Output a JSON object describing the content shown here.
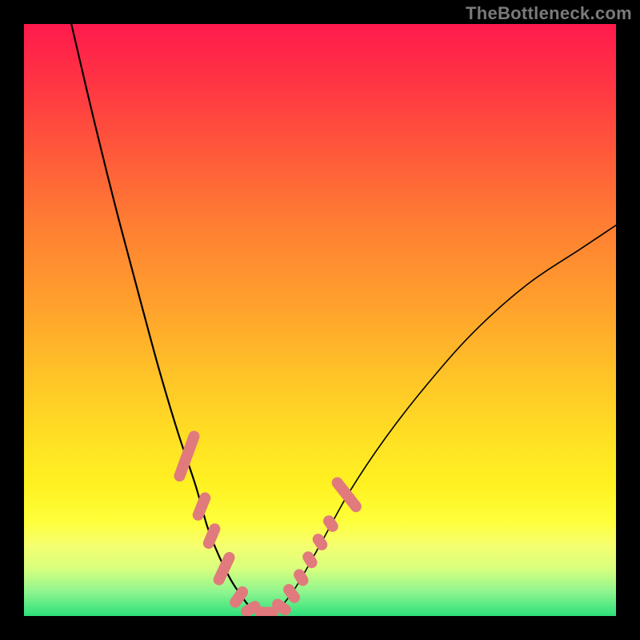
{
  "watermark": "TheBottleneck.com",
  "colors": {
    "background": "#000000",
    "gradient_top": "#ff1a4d",
    "gradient_bottom": "#2de07a",
    "curve": "#000000",
    "marker": "#e17a7c"
  },
  "chart_data": {
    "type": "line",
    "title": "",
    "xlabel": "",
    "ylabel": "",
    "xlim": [
      0,
      100
    ],
    "ylim": [
      0,
      100
    ],
    "grid": false,
    "legend": false,
    "note": "No axis ticks or numeric labels are rendered; values are estimated from pixel positions.",
    "series": [
      {
        "name": "left-branch",
        "x": [
          8,
          12,
          16,
          20,
          23,
          26,
          29,
          31,
          33,
          35,
          37,
          38.5
        ],
        "y": [
          100,
          83,
          67,
          52,
          41,
          31,
          22,
          15,
          10,
          6,
          3,
          1
        ]
      },
      {
        "name": "valley",
        "x": [
          38.5,
          40,
          41.5,
          43
        ],
        "y": [
          1,
          0.5,
          0.5,
          1
        ]
      },
      {
        "name": "right-branch",
        "x": [
          43,
          46,
          50,
          55,
          61,
          68,
          76,
          85,
          94,
          100
        ],
        "y": [
          1,
          5,
          12,
          21,
          30,
          39,
          48,
          56,
          62,
          66
        ]
      }
    ],
    "markers": {
      "name": "highlighted-segments",
      "shape": "rounded-bar",
      "color": "#e17a7c",
      "points": [
        {
          "x": 27.5,
          "y": 27,
          "angle": -70,
          "len": 9
        },
        {
          "x": 30,
          "y": 18.5,
          "angle": -68,
          "len": 5
        },
        {
          "x": 31.7,
          "y": 13.5,
          "angle": -67,
          "len": 4.5
        },
        {
          "x": 33.8,
          "y": 8,
          "angle": -65,
          "len": 6
        },
        {
          "x": 36.3,
          "y": 3.2,
          "angle": -55,
          "len": 4
        },
        {
          "x": 38.3,
          "y": 1.2,
          "angle": -30,
          "len": 3.5
        },
        {
          "x": 41,
          "y": 0.6,
          "angle": 0,
          "len": 4
        },
        {
          "x": 43.5,
          "y": 1.5,
          "angle": 35,
          "len": 3.5
        },
        {
          "x": 45.2,
          "y": 3.8,
          "angle": 55,
          "len": 3.5
        },
        {
          "x": 46.8,
          "y": 6.5,
          "angle": 58,
          "len": 3
        },
        {
          "x": 48.3,
          "y": 9.5,
          "angle": 58,
          "len": 3
        },
        {
          "x": 50,
          "y": 12.5,
          "angle": 56,
          "len": 3
        },
        {
          "x": 51.8,
          "y": 15.6,
          "angle": 55,
          "len": 3
        },
        {
          "x": 54.5,
          "y": 20.5,
          "angle": 52,
          "len": 7
        }
      ]
    }
  }
}
